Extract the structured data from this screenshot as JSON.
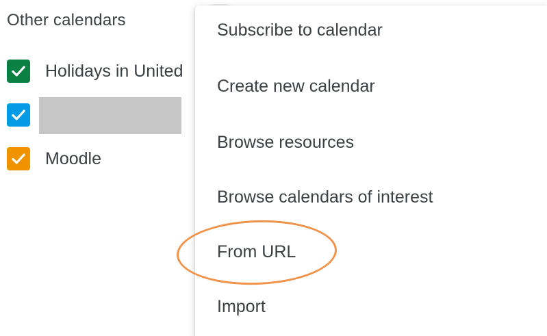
{
  "other_calendars": {
    "title": "Other calendars",
    "items": [
      {
        "label": "Holidays in United",
        "color": "#0b8043",
        "checked": true
      },
      {
        "label": "",
        "color": "#039be5",
        "checked": true
      },
      {
        "label": "Moodle",
        "color": "#f09300",
        "checked": true
      }
    ]
  },
  "menu": {
    "items": [
      {
        "label": "Subscribe to calendar"
      },
      {
        "label": "Create new calendar"
      },
      {
        "label": "Browse resources"
      },
      {
        "label": "Browse calendars of interest"
      },
      {
        "label": "From URL"
      },
      {
        "label": "Import"
      }
    ]
  },
  "annotation": {
    "highlight_color": "#f0934b"
  }
}
